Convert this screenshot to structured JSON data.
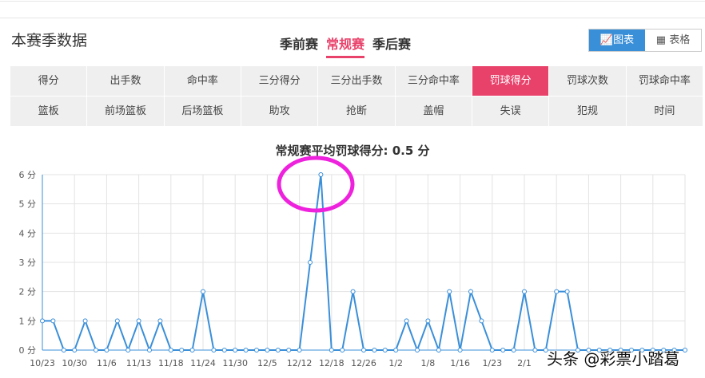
{
  "header": {
    "title": "本赛季数据",
    "seasons": [
      "季前赛",
      "常规赛",
      "季后赛"
    ],
    "active_season": "常规赛",
    "view_chart": "图表",
    "view_table": "表格"
  },
  "tabs": [
    "得分",
    "出手数",
    "命中率",
    "三分得分",
    "三分出手数",
    "三分命中率",
    "罚球得分",
    "罚球次数",
    "罚球命中率",
    "篮板",
    "前场篮板",
    "后场篮板",
    "助攻",
    "抢断",
    "盖帽",
    "失误",
    "犯规",
    "时间"
  ],
  "active_tab": "罚球得分",
  "watermark": "头条 @彩票小踏葛",
  "colors": {
    "accent": "#e8426b",
    "line": "#3a8fd9",
    "highlight": "#ee22dd"
  },
  "chart_data": {
    "type": "line",
    "title": "常规赛平均罚球得分: 0.5 分",
    "ylim": [
      0,
      6
    ],
    "yticks": [
      "0 分",
      "1 分",
      "2 分",
      "3 分",
      "4 分",
      "5 分",
      "6 分"
    ],
    "xtick_labels": [
      "10/23",
      "10/30",
      "11/6",
      "11/13",
      "11/18",
      "11/24",
      "11/30",
      "12/5",
      "12/12",
      "12/18",
      "12/26",
      "1/2",
      "1/8",
      "1/16",
      "1/23",
      "2/1"
    ],
    "xtick_every": 3,
    "values": [
      1,
      1,
      0,
      0,
      1,
      0,
      0,
      1,
      0,
      1,
      0,
      1,
      0,
      0,
      0,
      2,
      0,
      0,
      0,
      0,
      0,
      0,
      0,
      0,
      0,
      3,
      6,
      0,
      0,
      2,
      0,
      0,
      0,
      0,
      1,
      0,
      1,
      0,
      2,
      0,
      2,
      1,
      0,
      0,
      0,
      2,
      0,
      0,
      2,
      2,
      0,
      0,
      0,
      0,
      0,
      0,
      0,
      0,
      0,
      0,
      0
    ],
    "grid": true,
    "annotation": "circle around peak"
  }
}
